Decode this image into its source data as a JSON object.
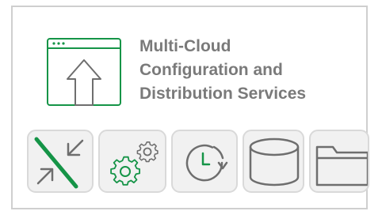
{
  "heading": {
    "lines": [
      "Multi-Cloud",
      "Configuration and",
      "Distribution Services"
    ]
  },
  "icons": {
    "hero": "browser-window-upload-icon",
    "tiles": [
      "collapse-arrows-icon",
      "gears-settings-icon",
      "clock-refresh-icon",
      "database-cylinder-icon",
      "folder-icon"
    ]
  },
  "colors": {
    "accent": "#159447",
    "icon_gray": "#6e6e6e",
    "title_gray": "#7a7a7a",
    "tile_bg": "#f1f1f1",
    "border": "#cfcfcf"
  }
}
